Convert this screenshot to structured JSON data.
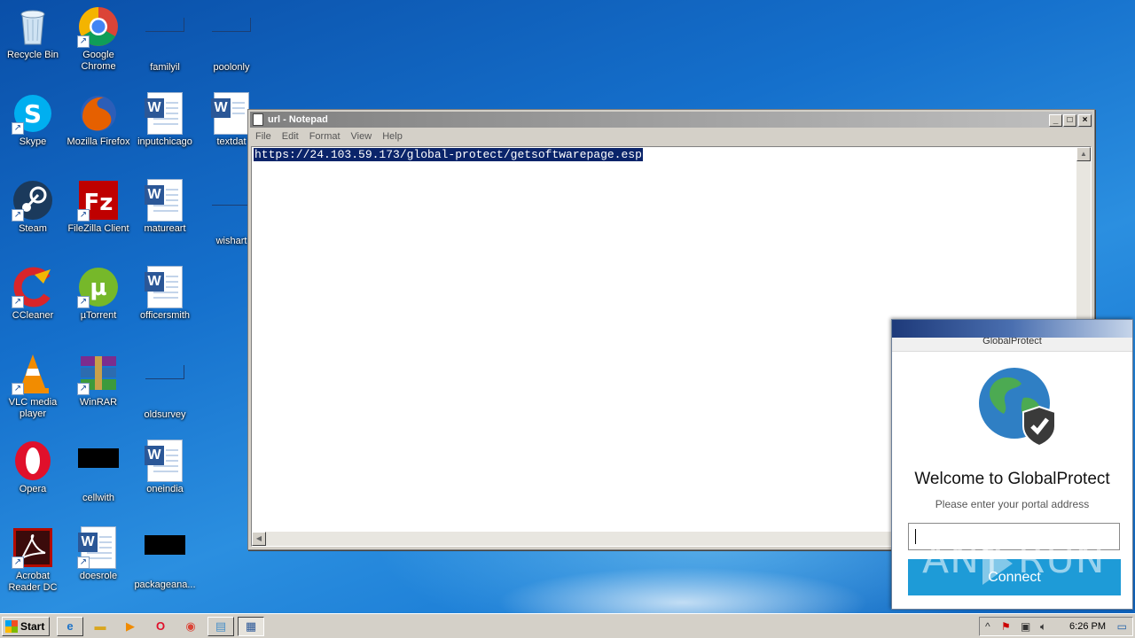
{
  "desktop_icons": [
    {
      "label": "Recycle Bin"
    },
    {
      "label": "Google Chrome"
    },
    {
      "label": "familyil"
    },
    {
      "label": "poolonly"
    },
    {
      "label": "Skype"
    },
    {
      "label": "Mozilla Firefox"
    },
    {
      "label": "inputchicago"
    },
    {
      "label": "textdat"
    },
    {
      "label": "Steam"
    },
    {
      "label": "FileZilla Client"
    },
    {
      "label": "matureart"
    },
    {
      "label": "wishart"
    },
    {
      "label": "CCleaner"
    },
    {
      "label": "µTorrent"
    },
    {
      "label": "officersmith"
    },
    {
      "label": "VLC media player"
    },
    {
      "label": "WinRAR"
    },
    {
      "label": "oldsurvey"
    },
    {
      "label": "Opera"
    },
    {
      "label": "cellwith"
    },
    {
      "label": "oneindia"
    },
    {
      "label": "Acrobat Reader DC"
    },
    {
      "label": "doesrole"
    },
    {
      "label": "packageana..."
    }
  ],
  "notepad": {
    "title": "url - Notepad",
    "menu": [
      "File",
      "Edit",
      "Format",
      "View",
      "Help"
    ],
    "content": "https://24.103.59.173/global-protect/getsoftwarepage.esp",
    "minimize": "_",
    "maximize": "□",
    "close": "×"
  },
  "globalprotect": {
    "title": "GlobalProtect",
    "welcome": "Welcome to GlobalProtect",
    "prompt": "Please enter your portal address",
    "input_value": "",
    "connect_label": "Connect"
  },
  "watermark": "ANY  RUN",
  "taskbar": {
    "start_label": "Start",
    "clock": "6:26 PM",
    "tray_up": "^"
  },
  "colors": {
    "gp_button": "#1e9bd7",
    "selection": "#0a246a"
  }
}
